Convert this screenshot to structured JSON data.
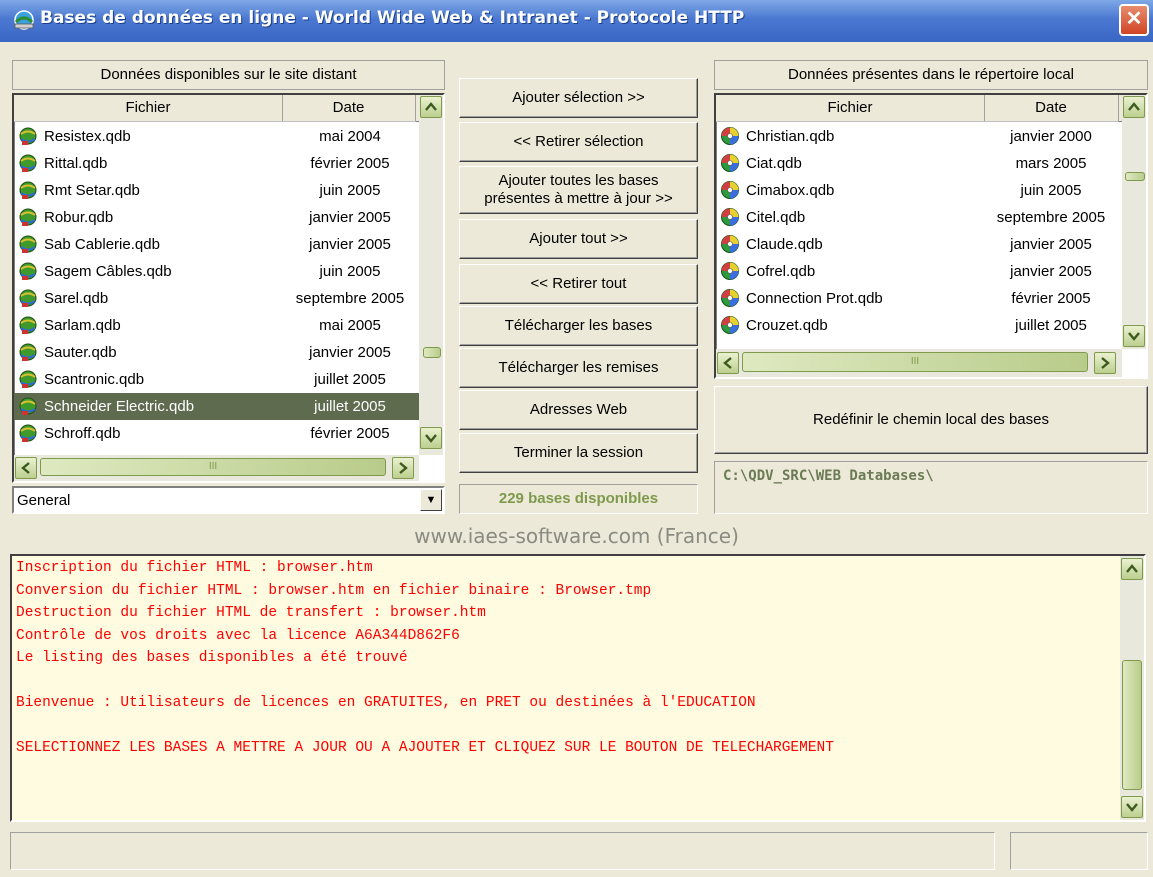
{
  "window": {
    "title": "Bases de données en ligne - World Wide Web & Intranet - Protocole HTTP",
    "close_label": "✕"
  },
  "remote": {
    "label": "Données disponibles sur le site distant",
    "col_file": "Fichier",
    "col_date": "Date",
    "rows": [
      {
        "name": "Resistex.qdb",
        "date": "mai 2004"
      },
      {
        "name": "Rittal.qdb",
        "date": "février 2005"
      },
      {
        "name": "Rmt Setar.qdb",
        "date": "juin 2005"
      },
      {
        "name": "Robur.qdb",
        "date": "janvier 2005"
      },
      {
        "name": "Sab Cablerie.qdb",
        "date": "janvier 2005"
      },
      {
        "name": "Sagem Câbles.qdb",
        "date": "juin 2005"
      },
      {
        "name": "Sarel.qdb",
        "date": "septembre 2005"
      },
      {
        "name": "Sarlam.qdb",
        "date": "mai 2005"
      },
      {
        "name": "Sauter.qdb",
        "date": "janvier 2005"
      },
      {
        "name": "Scantronic.qdb",
        "date": "juillet 2005"
      },
      {
        "name": "Schneider Electric.qdb",
        "date": "juillet 2005",
        "selected": true
      },
      {
        "name": "Schroff.qdb",
        "date": "février 2005"
      }
    ],
    "scroll_thumb_label": "III",
    "filter_value": "General",
    "filter_arrow": "▼"
  },
  "local": {
    "label": "Données présentes dans le répertoire local",
    "col_file": "Fichier",
    "col_date": "Date",
    "rows": [
      {
        "name": "Christian.qdb",
        "date": "janvier 2000"
      },
      {
        "name": "Ciat.qdb",
        "date": "mars 2005"
      },
      {
        "name": "Cimabox.qdb",
        "date": "juin 2005"
      },
      {
        "name": "Citel.qdb",
        "date": "septembre 2005"
      },
      {
        "name": "Claude.qdb",
        "date": "janvier 2005"
      },
      {
        "name": "Cofrel.qdb",
        "date": "janvier 2005"
      },
      {
        "name": "Connection Prot.qdb",
        "date": "février 2005"
      },
      {
        "name": "Crouzet.qdb",
        "date": "juillet 2005"
      }
    ],
    "scroll_thumb_label": "III",
    "redefine_button": "Redéfinir le chemin local des bases",
    "path": "C:\\QDV_SRC\\WEB Databases\\"
  },
  "buttons": {
    "add_selection": "Ajouter sélection >>",
    "remove_selection": "<< Retirer sélection",
    "add_all_update_1": "Ajouter toutes les bases",
    "add_all_update_2": "présentes à mettre à jour >>",
    "add_all": "Ajouter tout >>",
    "remove_all": "<< Retirer tout",
    "download_bases": "Télécharger les bases",
    "download_discounts": "Télécharger les remises",
    "web_addresses": "Adresses Web",
    "end_session": "Terminer la session"
  },
  "available_count": "229 bases disponibles",
  "website": "www.iaes-software.com (France)",
  "log": [
    "Inscription du fichier HTML : browser.htm",
    "Conversion du fichier HTML : browser.htm en fichier binaire : Browser.tmp",
    "Destruction du fichier HTML de transfert : browser.htm",
    "Contrôle de vos droits avec la licence A6A344D862F6",
    "Le listing des bases disponibles a été trouvé",
    "",
    "Bienvenue : Utilisateurs de licences en GRATUITES, en PRET ou destinées à l'EDUCATION",
    "",
    "SELECTIONNEZ LES BASES A METTRE A JOUR OU A AJOUTER ET CLIQUEZ SUR LE BOUTON DE TELECHARGEMENT"
  ],
  "status": {
    "main": "",
    "right": ""
  },
  "colors": {
    "selected_row": "#5e6b4e",
    "log_text": "#ff0000",
    "log_bg": "#fefbe0",
    "accent_green": "#7f9a4d"
  }
}
